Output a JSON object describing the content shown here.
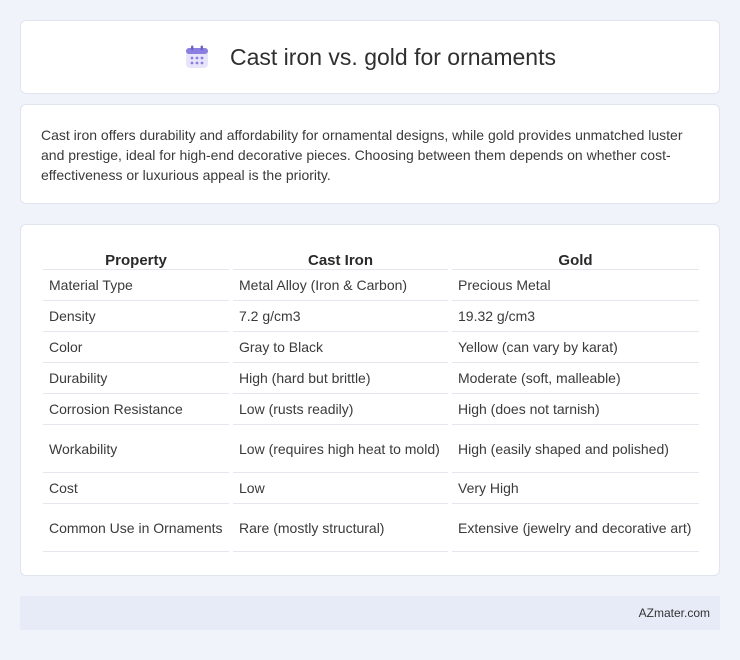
{
  "header": {
    "title": "Cast iron vs. gold for ornaments",
    "icon": "calendar-icon",
    "icon_color": "#8a7ee0"
  },
  "summary": {
    "text": "Cast iron offers durability and affordability for ornamental designs, while gold provides unmatched luster and prestige, ideal for high-end decorative pieces. Choosing between them depends on whether cost-effectiveness or luxurious appeal is the priority."
  },
  "table": {
    "headers": [
      "Property",
      "Cast Iron",
      "Gold"
    ],
    "rows": [
      [
        "Material Type",
        "Metal Alloy (Iron & Carbon)",
        "Precious Metal"
      ],
      [
        "Density",
        "7.2 g/cm3",
        "19.32 g/cm3"
      ],
      [
        "Color",
        "Gray to Black",
        "Yellow (can vary by karat)"
      ],
      [
        "Durability",
        "High (hard but brittle)",
        "Moderate (soft, malleable)"
      ],
      [
        "Corrosion Resistance",
        "Low (rusts readily)",
        "High (does not tarnish)"
      ],
      [
        "Workability",
        "Low (requires high heat to mold)",
        "High (easily shaped and polished)"
      ],
      [
        "Cost",
        "Low",
        "Very High"
      ],
      [
        "Common Use in Ornaments",
        "Rare (mostly structural)",
        "Extensive (jewelry and decorative art)"
      ]
    ]
  },
  "footer": {
    "text": "AZmater.com"
  }
}
